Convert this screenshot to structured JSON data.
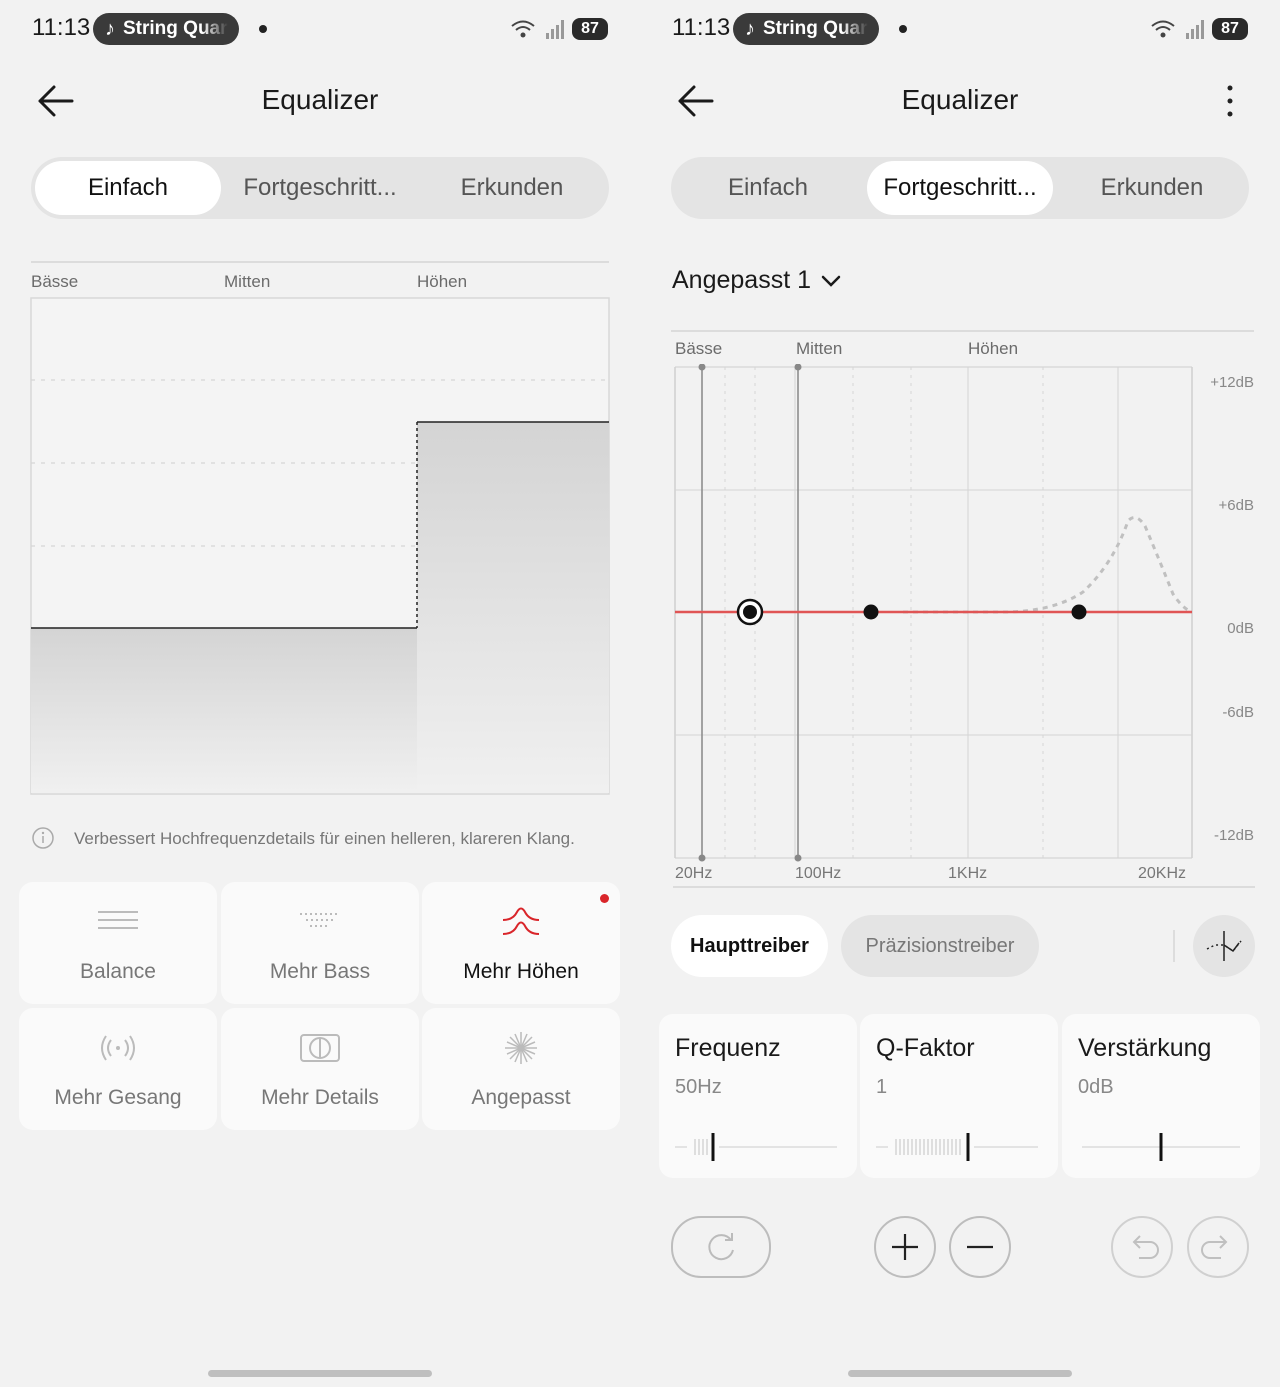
{
  "status": {
    "time": "11:13",
    "media": "String Quar",
    "battery": "87"
  },
  "left": {
    "title": "Equalizer",
    "tabs": [
      "Einfach",
      "Fortgeschritt...",
      "Erkunden"
    ],
    "bands": [
      "Bässe",
      "Mitten",
      "Höhen"
    ],
    "info": "Verbessert Hochfrequenzdetails für einen helleren, klareren Klang.",
    "presets": [
      {
        "label": "Balance",
        "icon": "balance-icon"
      },
      {
        "label": "Mehr Bass",
        "icon": "bass-icon"
      },
      {
        "label": "Mehr Höhen",
        "icon": "treble-icon",
        "selected": true
      },
      {
        "label": "Mehr Gesang",
        "icon": "vocal-icon"
      },
      {
        "label": "Mehr Details",
        "icon": "details-icon"
      },
      {
        "label": "Angepasst",
        "icon": "custom-icon"
      }
    ]
  },
  "right": {
    "title": "Equalizer",
    "tabs": [
      "Einfach",
      "Fortgeschritt...",
      "Erkunden"
    ],
    "preset_name": "Angepasst 1",
    "bands": [
      "Bässe",
      "Mitten",
      "Höhen"
    ],
    "db_labels": [
      "+12dB",
      "+6dB",
      "0dB",
      "-6dB",
      "-12dB"
    ],
    "freq_labels": [
      "20Hz",
      "100Hz",
      "1KHz",
      "20KHz"
    ],
    "drivers": [
      "Haupttreiber",
      "Präzisionstreiber"
    ],
    "params": [
      {
        "name": "Frequenz",
        "value": "50Hz"
      },
      {
        "name": "Q-Faktor",
        "value": "1"
      },
      {
        "name": "Verstärkung",
        "value": "0dB"
      }
    ]
  },
  "colors": {
    "accent": "#d9252a",
    "curve": "#e05555"
  }
}
